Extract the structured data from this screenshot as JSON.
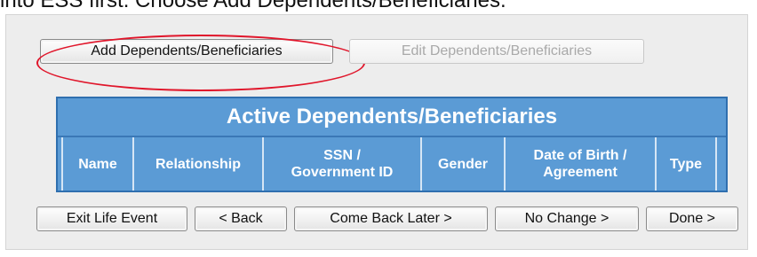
{
  "intro_text": "into ESS first.  Choose Add Dependents/Beneficiaries.",
  "buttons": {
    "add": "Add Dependents/Beneficiaries",
    "edit": "Edit Dependents/Beneficiaries"
  },
  "table": {
    "title": "Active Dependents/Beneficiaries",
    "columns": [
      {
        "line1": "Name",
        "line2": ""
      },
      {
        "line1": "Relationship",
        "line2": ""
      },
      {
        "line1": "SSN /",
        "line2": "Government ID"
      },
      {
        "line1": "Gender",
        "line2": ""
      },
      {
        "line1": "Date of Birth /",
        "line2": "Agreement"
      },
      {
        "line1": "Type",
        "line2": ""
      }
    ]
  },
  "nav_buttons": {
    "exit": "Exit Life Event",
    "back": "< Back",
    "come_back_later": "Come Back Later >",
    "no_change": "No Change >",
    "done": "Done >"
  },
  "colors": {
    "table_blue": "#5b9bd5",
    "highlight_red": "#e0162b",
    "panel_gray": "#ededed"
  }
}
